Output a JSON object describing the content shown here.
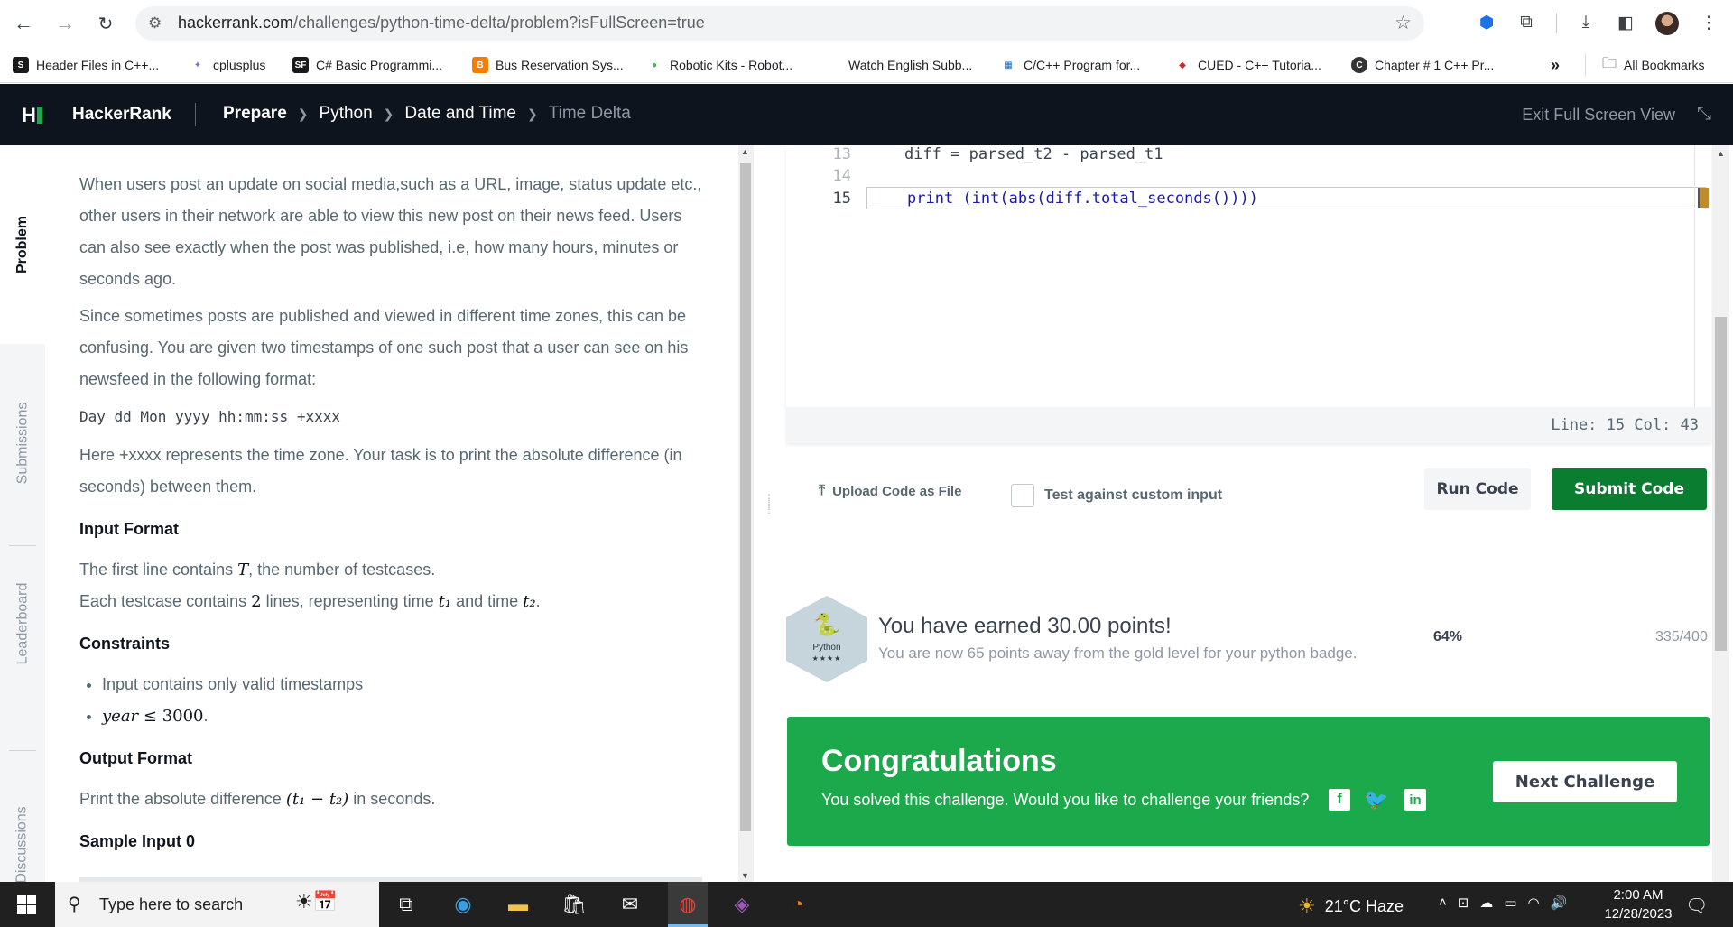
{
  "browser": {
    "url_domain": "hackerrank.com",
    "url_path": "/challenges/python-time-delta/problem?isFullScreen=true",
    "bookmarks": [
      {
        "label": "Header Files in C++...",
        "fav": "S",
        "color": "#1a1a1a"
      },
      {
        "label": "cplusplus",
        "fav": "✦",
        "color": "#7a6fd0"
      },
      {
        "label": "C# Basic Programmi...",
        "fav": "SF",
        "color": "#1a1a1a"
      },
      {
        "label": "Bus Reservation Sys...",
        "fav": "B",
        "color": "#f57c00"
      },
      {
        "label": "Robotic Kits - Robot...",
        "fav": "●",
        "color": "#4caf50"
      },
      {
        "label": "Watch English Subb...",
        "fav": "",
        "color": "#ffffff"
      },
      {
        "label": "C/C++ Program for...",
        "fav": "▦",
        "color": "#1565c0"
      },
      {
        "label": "CUED - C++ Tutoria...",
        "fav": "◆",
        "color": "#c62828"
      },
      {
        "label": "Chapter # 1 C++ Pr...",
        "fav": "C",
        "color": "#333333"
      }
    ],
    "more_label": "»",
    "all_bookmarks": "All Bookmarks"
  },
  "header": {
    "logo": "H",
    "brand": "HackerRank",
    "breadcrumbs": [
      "Prepare",
      "Python",
      "Date and Time",
      "Time Delta"
    ],
    "exit_fullscreen": "Exit Full Screen View"
  },
  "side_tabs": [
    "Problem",
    "Submissions",
    "Leaderboard",
    "Discussions"
  ],
  "problem": {
    "p1": "When users post an update on social media,such as a URL, image, status update etc., other users in their network are able to view this new post on their news feed. Users can also see exactly when the post was published, i.e, how many hours, minutes or seconds ago.",
    "p2": "Since sometimes posts are published and viewed in different time zones, this can be confusing. You are given two timestamps of one such post that a user can see on his newsfeed in the following format:",
    "format": "Day dd Mon yyyy hh:mm:ss +xxxx",
    "p3": "Here +xxxx represents the time zone. Your task is to print the absolute difference (in seconds) between them.",
    "input_heading": "Input Format",
    "input_1a": "The first line contains ",
    "input_1_var": "T",
    "input_1b": ", the number of testcases.",
    "input_2a": "Each testcase contains ",
    "input_2_num": "2",
    "input_2b": " lines, representing time ",
    "input_2_t1": "t₁",
    "input_2c": " and time ",
    "input_2_t2": "t₂",
    "input_2d": ".",
    "constraints_heading": "Constraints",
    "constraint_1": "Input contains only valid timestamps",
    "constraint_2_var": "year",
    "constraint_2_rest": " ≤ 3000",
    "constraint_2_end": ".",
    "output_heading": "Output Format",
    "output_a": "Print the absolute difference ",
    "output_math": "(t₁ − t₂)",
    "output_b": " in seconds.",
    "sample_heading": "Sample Input 0"
  },
  "editor": {
    "lines": [
      {
        "num": "13",
        "code": "    diff = parsed_t2 - parsed_t1"
      },
      {
        "num": "14",
        "code": ""
      },
      {
        "num": "15",
        "kw": "print",
        "code": " (int(abs(diff.total_seconds())))"
      }
    ],
    "cursor_status": "Line: 15 Col: 43"
  },
  "actions": {
    "upload": "Upload Code as File",
    "custom_input": "Test against custom input",
    "run": "Run Code",
    "submit": "Submit Code"
  },
  "points": {
    "badge_label": "Python",
    "badge_stars": "★★★★",
    "earned": "You have earned 30.00 points!",
    "away": "You are now 65 points away from the gold level for your python badge.",
    "percent": "64%",
    "score": "335/400"
  },
  "congrats": {
    "title": "Congratulations",
    "message": "You solved this challenge. Would you like to challenge your friends?",
    "next": "Next Challenge"
  },
  "taskbar": {
    "search_placeholder": "Type here to search",
    "weather": "21°C  Haze",
    "time": "2:00 AM",
    "date": "12/28/2023"
  }
}
